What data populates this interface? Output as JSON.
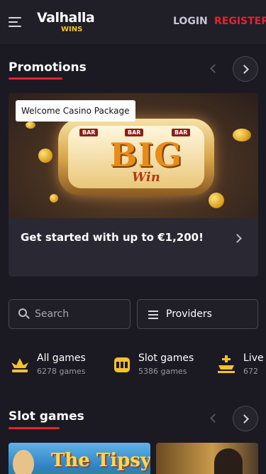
{
  "header": {
    "logo_top": "Valhalla",
    "logo_bottom": "WINS",
    "login_label": "LOGIN",
    "register_label": "REGISTER",
    "icons": {
      "menu": "hamburger-menu-icon"
    }
  },
  "promotions": {
    "title": "Promotions",
    "card": {
      "badge": "Welcome Casino Package",
      "text": "Get started with up to €1,200!",
      "banner_big": "BIG",
      "banner_win": "Win",
      "banner_tags": [
        "BAR",
        "BAR",
        "BAR"
      ]
    }
  },
  "search": {
    "placeholder": "Search"
  },
  "providers": {
    "label": "Providers"
  },
  "categories": [
    {
      "name": "All games",
      "count": "6278 games",
      "icon": "all-games-icon"
    },
    {
      "name": "Slot games",
      "count": "5386 games",
      "icon": "slot-machine-icon"
    },
    {
      "name": "Live",
      "count": "672",
      "icon": "live-casino-icon"
    }
  ],
  "slot_games": {
    "title": "Slot games",
    "card_title": "The Tipsy"
  },
  "colors": {
    "background": "#1b1922",
    "header": "#201e27",
    "accent_red": "#e2242e",
    "gold": "#f2c230"
  }
}
